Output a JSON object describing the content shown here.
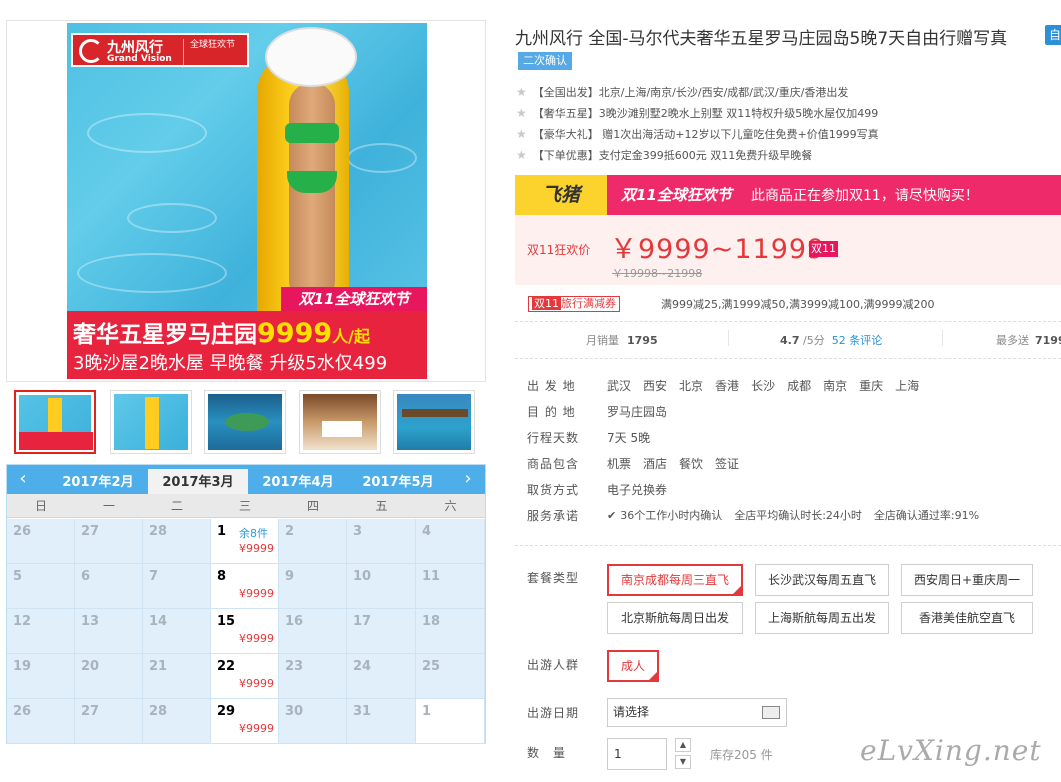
{
  "gallery": {
    "brand_name": "九州风行",
    "brand_en": "Grand Vision",
    "brand_festival": "全球狂欢节",
    "festival_badge": "双11全球狂欢节",
    "promo_line1_prefix": "奢华五星罗马庄园",
    "promo_price": "9999",
    "promo_line1_suffix": "人/起",
    "promo_line2": "3晚沙屋2晚水屋 早晚餐 升级5水仅499"
  },
  "calendar": {
    "prev_icon": "‹",
    "next_icon": "›",
    "months": [
      "2017年2月",
      "2017年3月",
      "2017年4月",
      "2017年5月"
    ],
    "active_month": "2017年3月",
    "weekdays": [
      "日",
      "一",
      "二",
      "三",
      "四",
      "五",
      "六"
    ],
    "rows": [
      [
        {
          "d": "26"
        },
        {
          "d": "27"
        },
        {
          "d": "28"
        },
        {
          "d": "1",
          "remain": "余8件",
          "price": "¥9999"
        },
        {
          "d": "2"
        },
        {
          "d": "3"
        },
        {
          "d": "4"
        }
      ],
      [
        {
          "d": "5"
        },
        {
          "d": "6"
        },
        {
          "d": "7"
        },
        {
          "d": "8",
          "price": "¥9999"
        },
        {
          "d": "9"
        },
        {
          "d": "10"
        },
        {
          "d": "11"
        }
      ],
      [
        {
          "d": "12"
        },
        {
          "d": "13"
        },
        {
          "d": "14"
        },
        {
          "d": "15",
          "price": "¥9999"
        },
        {
          "d": "16"
        },
        {
          "d": "17"
        },
        {
          "d": "18"
        }
      ],
      [
        {
          "d": "19"
        },
        {
          "d": "20"
        },
        {
          "d": "21"
        },
        {
          "d": "22",
          "price": "¥9999"
        },
        {
          "d": "23"
        },
        {
          "d": "24"
        },
        {
          "d": "25"
        }
      ],
      [
        {
          "d": "26"
        },
        {
          "d": "27"
        },
        {
          "d": "28"
        },
        {
          "d": "29",
          "price": "¥9999"
        },
        {
          "d": "30"
        },
        {
          "d": "31"
        },
        {
          "d": "1",
          "next": true
        }
      ]
    ]
  },
  "product": {
    "title": "九州风行 全国-马尔代夫奢华五星罗马庄园岛5晚7天自由行赠写真",
    "title_badge": "自",
    "confirm_tag": "二次确认",
    "features": [
      "【全国出发】北京/上海/南京/长沙/西安/成都/武汉/重庆/香港出发",
      "【奢华五星】3晚沙滩别墅2晚水上别墅 双11特权升级5晚水屋仅加499",
      "【豪华大礼】 赠1次出海活动+12岁以下儿童吃住免费+价值1999写真",
      "【下单优惠】支付定金399抵600元 双11免费升级早晚餐"
    ]
  },
  "banner": {
    "platform": "飞猪",
    "festival": "双11全球狂欢节",
    "text": "此商品正在参加双11，请尽快购买！"
  },
  "price": {
    "label": "双11狂欢价",
    "range": "￥9999~11999",
    "tag": "双11",
    "original": "￥19998~21998"
  },
  "coupon": {
    "tag_a": "双11",
    "tag_b": "旅行满减券",
    "text": "满999减25,满1999减50,满3999减100,满9999减200"
  },
  "stats": {
    "sales_label": "月销量",
    "sales_value": "1795",
    "rating_value": "4.7",
    "rating_suffix": "/5分",
    "reviews": "52 条评论",
    "gift_label": "最多送",
    "gift_value": "7199"
  },
  "info": {
    "depart_label": "出 发 地",
    "depart_cities": [
      "武汉",
      "西安",
      "北京",
      "香港",
      "长沙",
      "成都",
      "南京",
      "重庆",
      "上海"
    ],
    "dest_label": "目 的 地",
    "dest_value": "罗马庄园岛",
    "days_label": "行程天数",
    "days_value": "7天 5晚",
    "includes_label": "商品包含",
    "includes": [
      "机票",
      "酒店",
      "餐饮",
      "签证"
    ],
    "voucher_label": "取货方式",
    "voucher_value": "电子兑换券",
    "service_label": "服务承诺",
    "service_items": [
      "36个工作小时内确认",
      "全店平均确认时长:24小时",
      "全店确认通过率:91%"
    ]
  },
  "options": {
    "package_label": "套餐类型",
    "packages": [
      "南京成都每周三直飞",
      "长沙武汉每周五直飞",
      "西安周日+重庆周一",
      "北京斯航每周日出发",
      "上海斯航每周五出发",
      "香港美佳航空直飞"
    ],
    "selected_package": "南京成都每周三直飞",
    "people_label": "出游人群",
    "people": "成人",
    "date_label": "出游日期",
    "date_placeholder": "请选择",
    "qty_label": "数　量",
    "qty_value": "1",
    "stock": "库存205 件"
  },
  "watermark": "eLvXing.net",
  "colors": {
    "accent": "#e4393c",
    "calendar_header": "#4daeea",
    "banner": "#ee2a6b",
    "feizhu_yellow": "#fcd32c"
  }
}
